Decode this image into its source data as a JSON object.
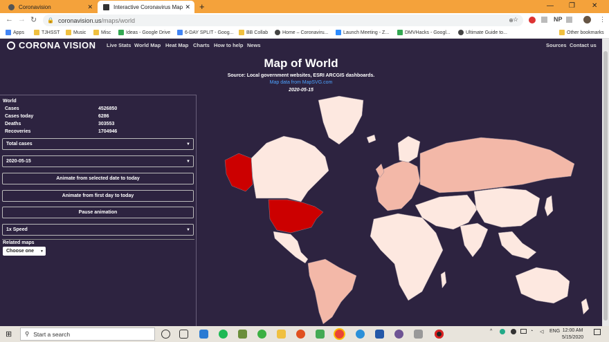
{
  "browser": {
    "tabs": [
      {
        "title": "Coronavision",
        "active": false
      },
      {
        "title": "Interactive Coronavirus Map - Co",
        "active": true
      }
    ],
    "url_domain": "coronavision.us",
    "url_path": "/maps/world",
    "bookmarks": [
      "Apps",
      "TJHSST",
      "Music",
      "Misc",
      "Ideas - Google Drive",
      "6-DAY SPLIT - Goog...",
      "BB Collab",
      "Home – Coronaviru...",
      "Launch Meeting - Z...",
      "DMVHacks - Googl...",
      "Ultimate Guide to..."
    ],
    "other_bookmarks": "Other bookmarks",
    "ext_labels": [
      "NP"
    ]
  },
  "site": {
    "logo": "CORONA VISION",
    "nav": [
      "Live Stats",
      "World Map",
      "Heat Map",
      "Charts",
      "How to help",
      "News"
    ],
    "nav_right": [
      "Sources",
      "Contact us"
    ],
    "title": "Map of World",
    "source": "Source: Local government websites, ESRI ARCGIS dashboards.",
    "mapsvg": "Map data from MapSVG.com",
    "date": "2020-05-15"
  },
  "panel": {
    "heading": "World",
    "stats": [
      {
        "label": "Cases",
        "value": "4526850"
      },
      {
        "label": "Cases today",
        "value": "6286"
      },
      {
        "label": "Deaths",
        "value": "303553"
      },
      {
        "label": "Recoveries",
        "value": "1704946"
      }
    ],
    "metric_select": "Total cases",
    "date_select": "2020-05-15",
    "animate_selected": "Animate from selected date to today",
    "animate_first": "Animate from first day to today",
    "pause": "Pause animation",
    "speed_select": "1x Speed",
    "related_label": "Related maps",
    "related_select": "Choose one"
  },
  "taskbar": {
    "search_placeholder": "Start a search",
    "lang": "ENG",
    "time": "12:00 AM",
    "date": "5/15/2020"
  },
  "colors": {
    "background": "#2d2340",
    "map_high": "#cc0000",
    "map_mid": "#f3b8a8",
    "map_low": "#fde8e0",
    "tab_bar": "#f4a23b",
    "link": "#4da3ff"
  }
}
